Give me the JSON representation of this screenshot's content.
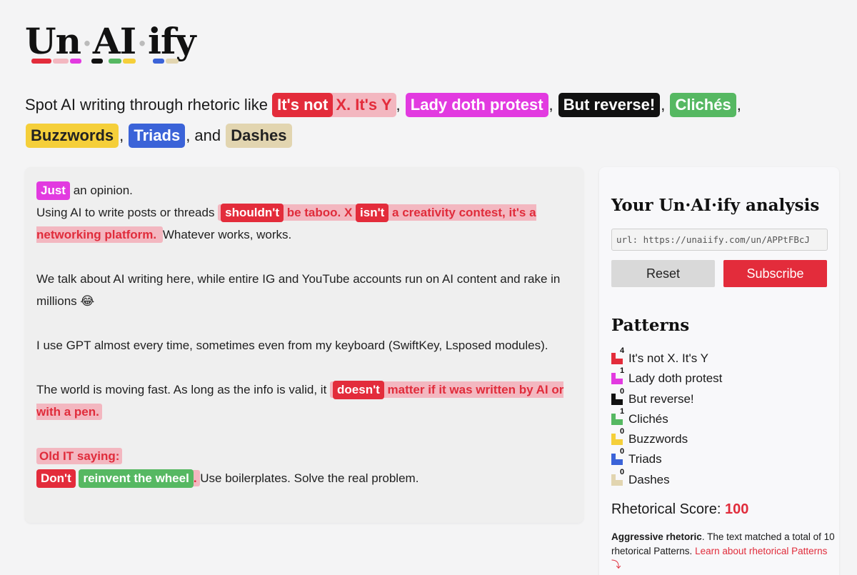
{
  "logo": {
    "parts": [
      "Un",
      "AI",
      "ify"
    ],
    "dot": "·"
  },
  "tagline": {
    "prefix": "Spot AI writing through rhetoric like",
    "tags": [
      {
        "inner": "It's not",
        "rest": "X. It's Y"
      },
      {
        "label": "Lady doth protest"
      },
      {
        "label": "But reverse!"
      },
      {
        "label": "Clichés"
      },
      {
        "label": "Buzzwords"
      },
      {
        "label": "Triads"
      },
      {
        "label": "Dashes"
      }
    ],
    "comma": ",",
    "and": ", and"
  },
  "text": {
    "p1_chip": "Just",
    "p1_rest": " an opinion.",
    "p1_line2_start": "Using AI to write posts or threads ",
    "p1_chip2": "shouldn't",
    "p1_hl2": " be taboo. X ",
    "p1_chip3": "isn't",
    "p1_hl3": " a creativity contest, it's a networking platform. ",
    "p1_end": " Whatever works, works.",
    "p2": "We talk about AI writing here, while entire IG and YouTube accounts run on AI content and rake in millions 😂",
    "p3": "I use GPT almost every time, sometimes even from my keyboard (SwiftKey, Lsposed modules).",
    "p4_start": "The world is moving fast. As long as the info is valid, it ",
    "p4_chip": "doesn't",
    "p4_hl": " matter if it was written by AI or with a pen. ",
    "p5_hl": "Old IT saying:",
    "p5_chip_red": "Don't",
    "p5_chip_green": "reinvent the wheel",
    "p5_dot": ". ",
    "p5_rest": " Use boilerplates. Solve the real problem."
  },
  "sidebar": {
    "title": "Your Un·AI·ify analysis",
    "url_value": "url: https://unaiify.com/un/APPtFBcJ",
    "reset_label": "Reset",
    "subscribe_label": "Subscribe",
    "patterns_title": "Patterns",
    "patterns": [
      {
        "label": "It's not X. It's Y",
        "count": "4",
        "color": "#e32c3b"
      },
      {
        "label": "Lady doth protest",
        "count": "1",
        "color": "#e23ae0"
      },
      {
        "label": "But reverse!",
        "count": "0",
        "color": "#111111"
      },
      {
        "label": "Clichés",
        "count": "1",
        "color": "#56b862"
      },
      {
        "label": "Buzzwords",
        "count": "0",
        "color": "#f5cf3a"
      },
      {
        "label": "Triads",
        "count": "0",
        "color": "#3b63d8"
      },
      {
        "label": "Dashes",
        "count": "0",
        "color": "#e2d5b0"
      }
    ],
    "score_label": "Rhetorical Score:",
    "score_value": "100",
    "desc_bold": "Aggressive rhetoric",
    "desc_text": ". The text matched a total of 10 rhetorical Patterns. ",
    "learn_link": "Learn about rhetorical Patterns ⤵"
  },
  "colors": {
    "red": "#e32c3b",
    "pink": "#e23ae0",
    "black": "#111111",
    "green": "#56b862",
    "yellow": "#f5cf3a",
    "blue": "#3b63d8",
    "tan": "#e2d5b0",
    "highlight_bg": "#f3b7c0"
  }
}
